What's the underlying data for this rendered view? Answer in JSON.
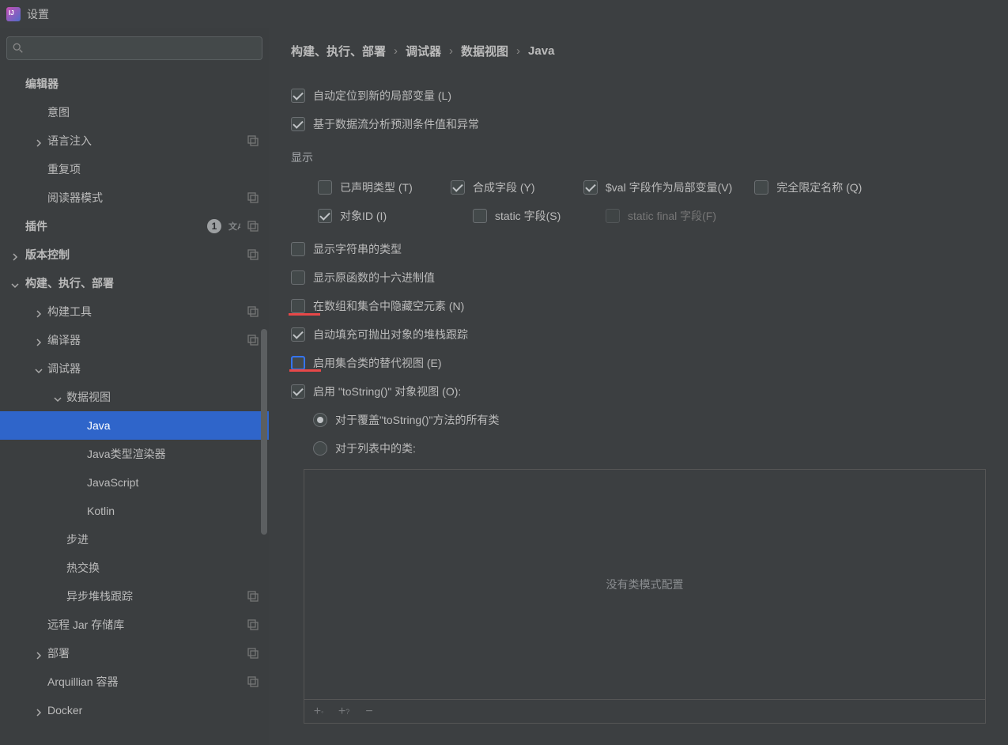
{
  "window": {
    "title": "设置"
  },
  "search": {
    "placeholder": ""
  },
  "sidebar": {
    "items": [
      {
        "label": "编辑器",
        "level": 0,
        "expand": "none"
      },
      {
        "label": "意图",
        "level": 1,
        "expand": "none"
      },
      {
        "label": "语言注入",
        "level": 1,
        "expand": "right",
        "overlays": true
      },
      {
        "label": "重复项",
        "level": 1,
        "expand": "none"
      },
      {
        "label": "阅读器模式",
        "level": 1,
        "expand": "none",
        "overlays": true
      },
      {
        "label": "插件",
        "level": 0,
        "expand": "none",
        "badge": "1",
        "lang": true,
        "overlays": true
      },
      {
        "label": "版本控制",
        "level": 0,
        "expand": "right",
        "overlays": true
      },
      {
        "label": "构建、执行、部署",
        "level": 0,
        "expand": "down"
      },
      {
        "label": "构建工具",
        "level": 1,
        "expand": "right",
        "overlays": true
      },
      {
        "label": "编译器",
        "level": 1,
        "expand": "right",
        "overlays": true
      },
      {
        "label": "调试器",
        "level": 1,
        "expand": "down"
      },
      {
        "label": "数据视图",
        "level": 2,
        "expand": "down"
      },
      {
        "label": "Java",
        "level": 3,
        "expand": "none",
        "selected": true
      },
      {
        "label": "Java类型渲染器",
        "level": 3,
        "expand": "none"
      },
      {
        "label": "JavaScript",
        "level": 3,
        "expand": "none"
      },
      {
        "label": "Kotlin",
        "level": 3,
        "expand": "none"
      },
      {
        "label": "步进",
        "level": 2,
        "expand": "none"
      },
      {
        "label": "热交换",
        "level": 2,
        "expand": "none"
      },
      {
        "label": "异步堆栈跟踪",
        "level": 2,
        "expand": "none",
        "overlays": true
      },
      {
        "label": "远程 Jar 存储库",
        "level": 1,
        "expand": "none",
        "overlays": true
      },
      {
        "label": "部署",
        "level": 1,
        "expand": "right",
        "overlays": true
      },
      {
        "label": "Arquillian 容器",
        "level": 1,
        "expand": "none",
        "overlays": true
      },
      {
        "label": "Docker",
        "level": 1,
        "expand": "right"
      }
    ]
  },
  "breadcrumb": {
    "seg1": "构建、执行、部署",
    "seg2": "调试器",
    "seg3": "数据视图",
    "seg4": "Java",
    "sep": "›"
  },
  "options": {
    "auto_locate": "自动定位到新的局部变量 (L)",
    "predict_dataflow": "基于数据流分析预测条件值和异常",
    "display_heading": "显示",
    "declared_type": "已声明类型 (T)",
    "synthetic_field": "合成字段 (Y)",
    "val_field_local": "$val 字段作为局部变量(V)",
    "fully_qualified": "完全限定名称 (Q)",
    "object_id": "对象ID (I)",
    "static_field": "static 字段(S)",
    "static_final_field": "static final 字段(F)",
    "show_string_type": "显示字符串的类型",
    "show_primitive_hex": "显示原函数的十六进制值",
    "hide_empty": "在数组和集合中隐藏空元素 (N)",
    "auto_fill_throwable": "自动填充可抛出对象的堆栈跟踪",
    "enable_collection_alt": "启用集合类的替代视图 (E)",
    "enable_tostring": "启用 \"toString()\" 对象视图 (O):",
    "radio_override": "对于覆盖\"toString()\"方法的所有类",
    "radio_listed": "对于列表中的类:",
    "no_pattern": "没有类模式配置"
  }
}
